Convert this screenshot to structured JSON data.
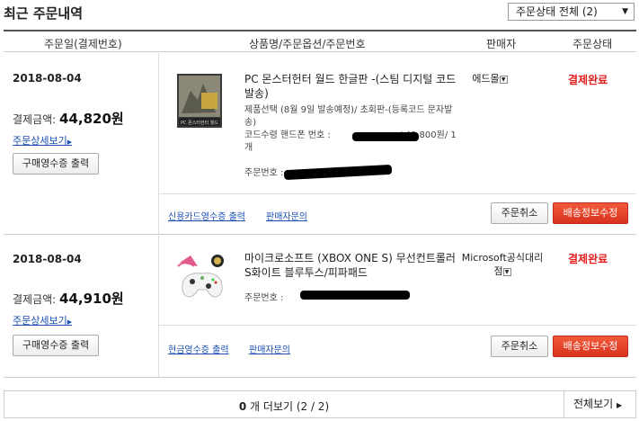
{
  "header": {
    "title": "최근 주문내역",
    "status_filter": "주문상태 전체 (2)"
  },
  "columns": [
    "주문일(결제번호)",
    "상품명/주문옵션/주문번호",
    "판매자",
    "주문상태"
  ],
  "orders": [
    {
      "date": "2018-08-04",
      "pay_label": "결제금액:",
      "amount": "44,820원",
      "detail_link": "주문상세보기",
      "receipt_button": "구매영수증 출력",
      "product_title": "PC 몬스터헌터 월드 한글판 -(스팀 디지털 코드발송)",
      "options": "제품선택 (8월 9일 발송예정)/ 초회판-(등록코드 문자발송)",
      "options2": "코드수령 핸드폰 번호 :",
      "options3": "/ 49,800원/ 1개",
      "order_no_label": "주문번호 :",
      "seller": "에드몰",
      "status": "결제완료",
      "footer_link1": "신용카드영수증 출력",
      "footer_link2": "판매자문의",
      "cancel_button": "주문취소",
      "shipping_button": "배송정보수정",
      "thumb_text": "PC 몬스터헌터 월드"
    },
    {
      "date": "2018-08-04",
      "pay_label": "결제금액:",
      "amount": "44,910원",
      "detail_link": "주문상세보기",
      "receipt_button": "구매영수증 출력",
      "product_title": "마이크로소프트 (XBOX ONE S) 무선컨트롤러S화이트 블루투스/피파패드",
      "order_no_label": "주문번호 :",
      "seller": "Microsoft공식대리점",
      "status": "결제완료",
      "footer_link1": "현금영수증 출력",
      "footer_link2": "판매자문의",
      "cancel_button": "주문취소",
      "shipping_button": "배송정보수정"
    }
  ],
  "pager": {
    "count": "0",
    "more_text": "개 더보기 (2 / 2)",
    "all_button": "전체보기"
  },
  "colors": {
    "status_red": "#e31b1b",
    "link_blue": "#1a4fb0",
    "button_red": "#d8311d"
  }
}
